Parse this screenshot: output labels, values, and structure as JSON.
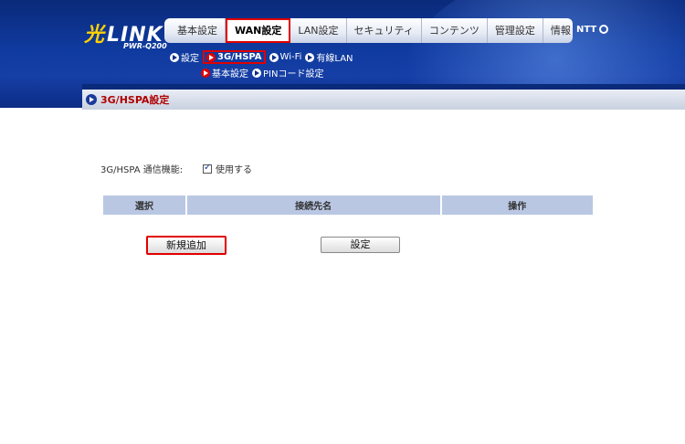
{
  "header": {
    "logo_mark": "光",
    "logo_text": "LINK",
    "model": "PWR-Q200",
    "brand": "NTT"
  },
  "main_nav": [
    {
      "label": "基本設定",
      "active": false
    },
    {
      "label": "WAN設定",
      "active": true
    },
    {
      "label": "LAN設定",
      "active": false
    },
    {
      "label": "セキュリティ",
      "active": false
    },
    {
      "label": "コンテンツ",
      "active": false
    },
    {
      "label": "管理設定",
      "active": false
    },
    {
      "label": "情報",
      "active": false
    }
  ],
  "sub_nav": [
    {
      "label": "設定",
      "active": false
    },
    {
      "label": "3G/HSPA",
      "active": true
    },
    {
      "label": "Wi-Fi",
      "active": false
    },
    {
      "label": "有線LAN",
      "active": false
    }
  ],
  "sub_nav2": [
    {
      "label": "基本設定",
      "active": true
    },
    {
      "label": "PINコード設定",
      "active": false
    }
  ],
  "page_title": "3G/HSPA設定",
  "form": {
    "label": "3G/HSPA 通信機能:",
    "checkbox_label": "使用する",
    "checked": true
  },
  "table": {
    "headers": [
      "選択",
      "接続先名",
      "操作"
    ]
  },
  "buttons": {
    "new_label": "新規追加",
    "set_label": "設定"
  },
  "colors": {
    "header_blue": "#0f3a9e",
    "highlight_red": "#e00000",
    "table_header": "#b9c7e3",
    "title_text": "#b00000"
  }
}
